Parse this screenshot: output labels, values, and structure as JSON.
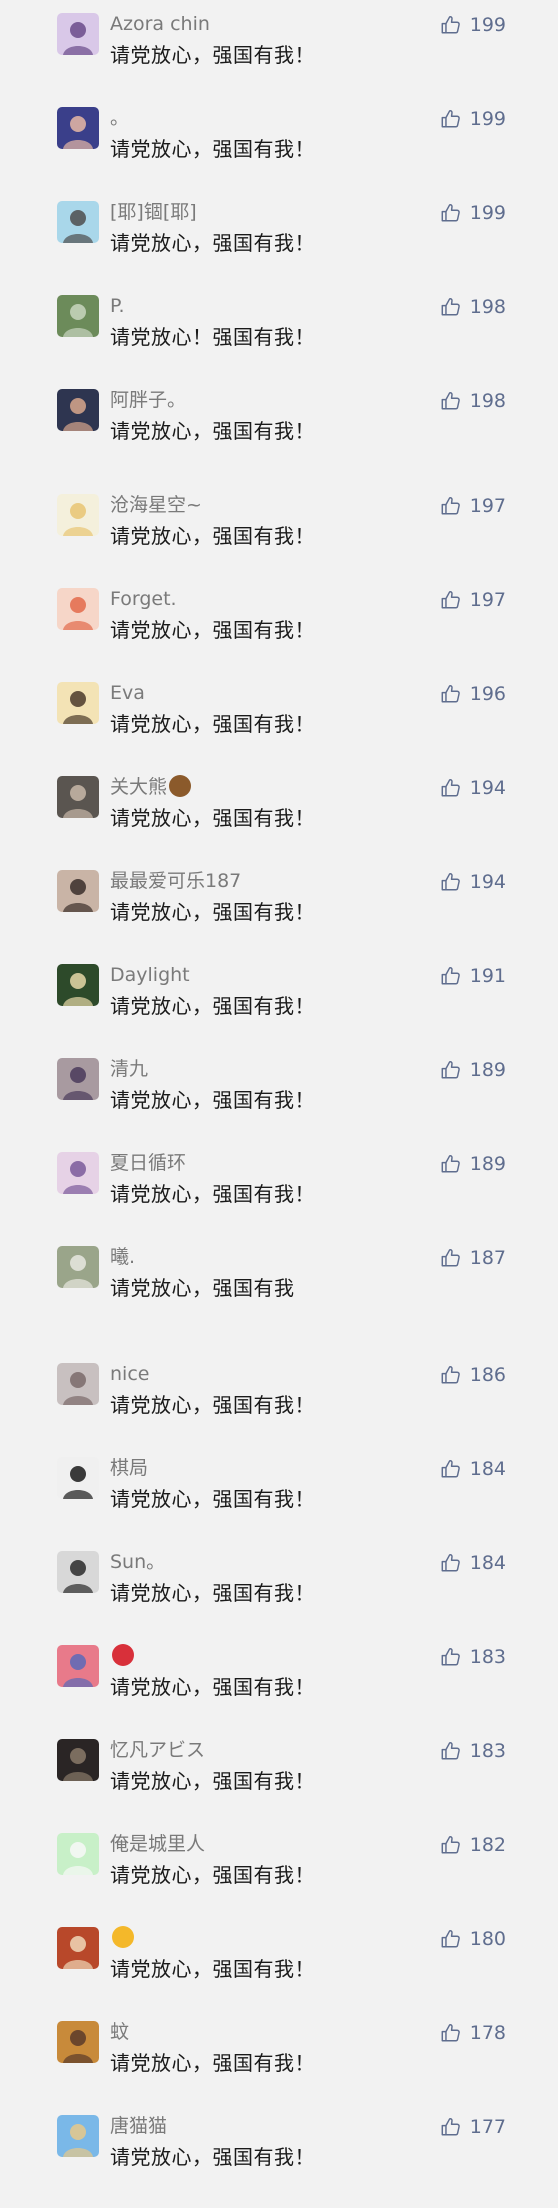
{
  "comments": [
    {
      "nickname": "Azora chin",
      "text": "请党放心，强国有我！",
      "likes": "199",
      "avatar_colors": [
        "#d9c8e8",
        "#6a4a8a"
      ]
    },
    {
      "nickname": "。",
      "text": "请党放心，强国有我！",
      "likes": "199",
      "avatar_colors": [
        "#3a3f8a",
        "#e7b9a5"
      ]
    },
    {
      "nickname": "[耶]锢[耶]",
      "text": "请党放心，强国有我！",
      "likes": "199",
      "avatar_colors": [
        "#a9d7ea",
        "#4d4d4d"
      ]
    },
    {
      "nickname": "P.",
      "text": "请党放心！强国有我！",
      "likes": "198",
      "avatar_colors": [
        "#6c8b5a",
        "#c9d6c0"
      ]
    },
    {
      "nickname": "阿胖子。",
      "text": "请党放心，强国有我！",
      "likes": "198",
      "avatar_colors": [
        "#2e3550",
        "#d8a78c"
      ]
    },
    {
      "nickname": "沧海星空~",
      "text": "请党放心，强国有我！",
      "likes": "197",
      "avatar_colors": [
        "#f4f0dc",
        "#e8c472"
      ]
    },
    {
      "nickname": "Forget.",
      "text": "请党放心，强国有我！",
      "likes": "197",
      "avatar_colors": [
        "#f6d6c8",
        "#e36a4a"
      ]
    },
    {
      "nickname": "Eva",
      "text": "请党放心，强国有我！",
      "likes": "196",
      "avatar_colors": [
        "#f3e3b5",
        "#4a3a2a"
      ]
    },
    {
      "nickname": "关大熊",
      "text": "请党放心，强国有我！",
      "likes": "194",
      "avatar_colors": [
        "#5a5550",
        "#c8b8a8"
      ],
      "badge_color": "#8b5a2b"
    },
    {
      "nickname": "最最爱可乐187",
      "text": "请党放心，强国有我！",
      "likes": "194",
      "avatar_colors": [
        "#c9b4a6",
        "#3a2e2a"
      ]
    },
    {
      "nickname": "Daylight",
      "text": "请党放心，强国有我！",
      "likes": "191",
      "avatar_colors": [
        "#2d4a2a",
        "#e8d8a8"
      ]
    },
    {
      "nickname": "清九",
      "text": "请党放心，强国有我！",
      "likes": "189",
      "avatar_colors": [
        "#a89aa0",
        "#4a3a5a"
      ]
    },
    {
      "nickname": "夏日循环",
      "text": "请党放心，强国有我！",
      "likes": "189",
      "avatar_colors": [
        "#e6d2e6",
        "#7a5a9a"
      ]
    },
    {
      "nickname": "曦.",
      "text": "请党放心，强国有我",
      "likes": "187",
      "avatar_colors": [
        "#9aa58a",
        "#e8e8e0"
      ]
    },
    {
      "nickname": "nice",
      "text": "请党放心，强国有我！",
      "likes": "186",
      "avatar_colors": [
        "#c8c0c0",
        "#7a6a6a"
      ]
    },
    {
      "nickname": "棋局",
      "text": "请党放心，强国有我！",
      "likes": "184",
      "avatar_colors": [
        "#f0f0f0",
        "#1a1a1a"
      ]
    },
    {
      "nickname": "Sun。",
      "text": "请党放心，强国有我！",
      "likes": "184",
      "avatar_colors": [
        "#d8d8d8",
        "#2a2a2a"
      ]
    },
    {
      "nickname": "",
      "text": "请党放心，强国有我！",
      "likes": "183",
      "avatar_colors": [
        "#e87a8a",
        "#5a6ab8"
      ],
      "badge_color": "#d8303a"
    },
    {
      "nickname": "忆凡アビス",
      "text": "请党放心，强国有我！",
      "likes": "183",
      "avatar_colors": [
        "#2a2525",
        "#8a7a6a"
      ]
    },
    {
      "nickname": "俺是城里人",
      "text": "请党放心，强国有我！",
      "likes": "182",
      "avatar_colors": [
        "#c8f0c8",
        "#f8f8f8"
      ]
    },
    {
      "nickname": "",
      "text": "请党放心，强国有我！",
      "likes": "180",
      "avatar_colors": [
        "#b8482a",
        "#f0d8b8"
      ],
      "badge_color": "#f4b82a"
    },
    {
      "nickname": "蚊",
      "text": "请党放心，强国有我！",
      "likes": "178",
      "avatar_colors": [
        "#c88a3a",
        "#5a3a2a"
      ]
    },
    {
      "nickname": "唐猫猫",
      "text": "请党放心，强国有我！",
      "likes": "177",
      "avatar_colors": [
        "#7ab8e8",
        "#e8c888"
      ]
    }
  ],
  "icons": {
    "like": "thumbs-up-icon"
  },
  "colors": {
    "background": "#f2f2f2",
    "nickname": "#7a7a7a",
    "text": "#1a1a1a",
    "like": "#5f6d8e"
  }
}
